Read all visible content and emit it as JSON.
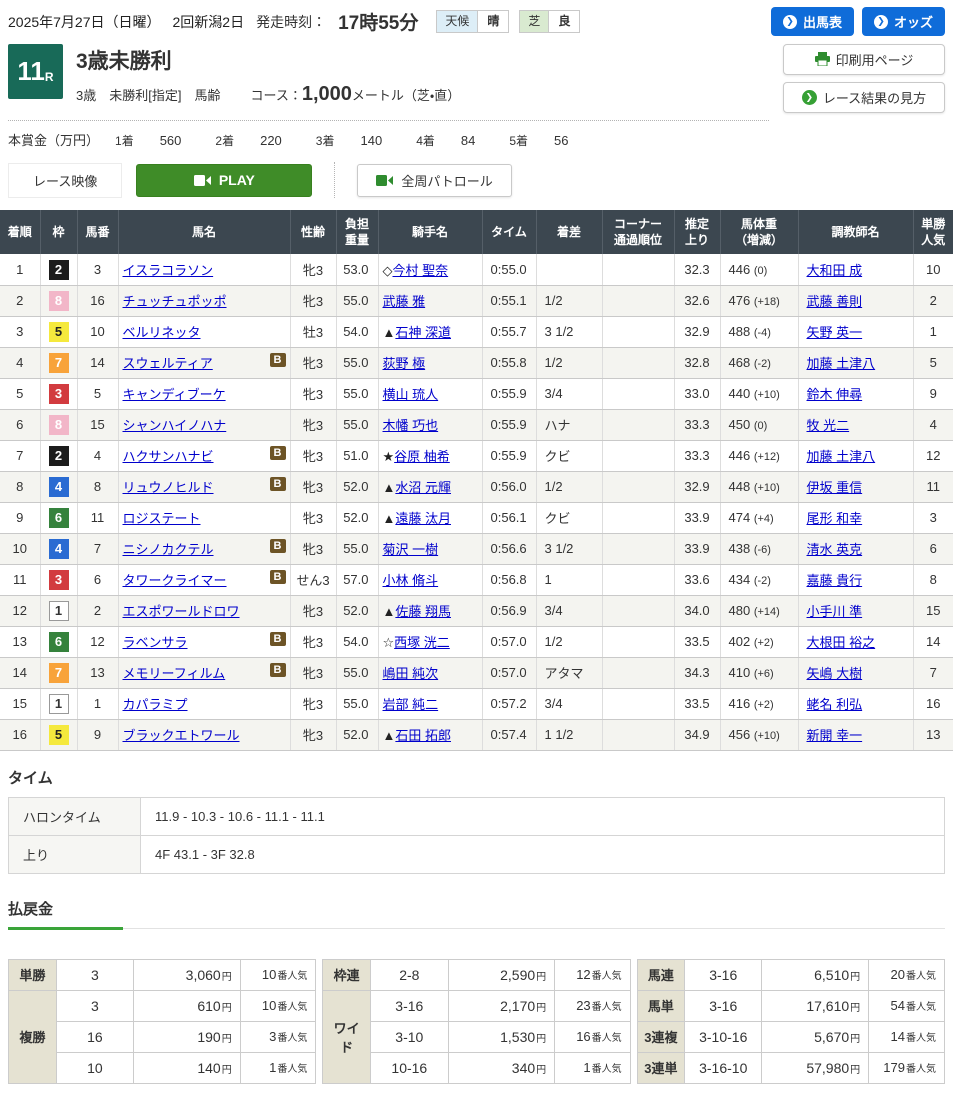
{
  "topbar": {
    "date": "2025年7月27日（日曜）",
    "meeting": "2回新潟2日",
    "start_label": "発走時刻：",
    "start_time": "17時55分",
    "weather_label": "天候",
    "weather_value": "晴",
    "turf_label": "芝",
    "turf_value": "良",
    "shutsuba_button": "出馬表",
    "odds_button": "オッズ"
  },
  "race": {
    "number": "11",
    "number_suffix": "R",
    "title": "3歳未勝利",
    "conditions": "3歳　未勝利[指定]　馬齢",
    "course_label": "コース：",
    "course_value": "1,000",
    "course_unit": "メートル（芝・直）",
    "print_button": "印刷用ページ",
    "guide_button": "レース結果の見方"
  },
  "prize": {
    "label": "本賞金（万円）",
    "items": [
      {
        "rank": "1着",
        "amount": "560"
      },
      {
        "rank": "2着",
        "amount": "220"
      },
      {
        "rank": "3着",
        "amount": "140"
      },
      {
        "rank": "4着",
        "amount": "84"
      },
      {
        "rank": "5着",
        "amount": "56"
      }
    ]
  },
  "video": {
    "label": "レース映像",
    "play_button": "PLAY",
    "patrol_button": "全周パトロール"
  },
  "colors": {
    "accent_blue": "#0f6cd9",
    "play_green": "#3f8c28",
    "icon_green": "#36a035",
    "race_number_teal": "#186a58",
    "table_header": "#3c4750",
    "link_blue": "#0000cc",
    "blinkers_brown": "#6d5426",
    "payout_label_bg": "#e5e2d2",
    "payout_underline_green": "#3aa439",
    "frames": {
      "white": {
        "bg": "#ffffff",
        "fg": "#333333",
        "border": "#999999"
      },
      "black": {
        "bg": "#1c1c1c",
        "fg": "#ffffff"
      },
      "red": {
        "bg": "#d23b3f",
        "fg": "#ffffff"
      },
      "blue": {
        "bg": "#2a6bd2",
        "fg": "#ffffff"
      },
      "yellow": {
        "bg": "#f5e93d",
        "fg": "#222222"
      },
      "green": {
        "bg": "#35823c",
        "fg": "#ffffff"
      },
      "orange": {
        "bg": "#f8a33a",
        "fg": "#ffffff"
      },
      "pink": {
        "bg": "#f2b6c8",
        "fg": "#ffffff"
      }
    }
  },
  "results": {
    "columns": [
      "着順",
      "枠",
      "馬番",
      "馬名",
      "性齢",
      "負担\n重量",
      "騎手名",
      "タイム",
      "着差",
      "コーナー\n通過順位",
      "推定\n上り",
      "馬体重\n（増減）",
      "調教師名",
      "単勝\n人気"
    ],
    "rows": [
      {
        "pos": "1",
        "frame": "2",
        "frame_color": "black",
        "num": "3",
        "horse": "イスラコラソン",
        "blinkers": false,
        "sex_age": "牝3",
        "weight": "53.0",
        "jockey_prefix": "◇",
        "jockey": "今村 聖奈",
        "time": "0:55.0",
        "margin": "",
        "corner": "",
        "last3f": "32.3",
        "body": "446",
        "body_diff": "(0)",
        "trainer": "大和田 成",
        "pop": "10"
      },
      {
        "pos": "2",
        "frame": "8",
        "frame_color": "pink",
        "num": "16",
        "horse": "チュッチュポッポ",
        "blinkers": false,
        "sex_age": "牝3",
        "weight": "55.0",
        "jockey_prefix": "",
        "jockey": "武藤 雅",
        "time": "0:55.1",
        "margin": "1/2",
        "corner": "",
        "last3f": "32.6",
        "body": "476",
        "body_diff": "(+18)",
        "trainer": "武藤 善則",
        "pop": "2"
      },
      {
        "pos": "3",
        "frame": "5",
        "frame_color": "yellow",
        "num": "10",
        "horse": "ベルリネッタ",
        "blinkers": false,
        "sex_age": "牡3",
        "weight": "54.0",
        "jockey_prefix": "▲",
        "jockey": "石神 深道",
        "time": "0:55.7",
        "margin": "3 1/2",
        "corner": "",
        "last3f": "32.9",
        "body": "488",
        "body_diff": "(-4)",
        "trainer": "矢野 英一",
        "pop": "1"
      },
      {
        "pos": "4",
        "frame": "7",
        "frame_color": "orange",
        "num": "14",
        "horse": "スウェルティア",
        "blinkers": true,
        "sex_age": "牝3",
        "weight": "55.0",
        "jockey_prefix": "",
        "jockey": "荻野 極",
        "time": "0:55.8",
        "margin": "1/2",
        "corner": "",
        "last3f": "32.8",
        "body": "468",
        "body_diff": "(-2)",
        "trainer": "加藤 土津八",
        "pop": "5"
      },
      {
        "pos": "5",
        "frame": "3",
        "frame_color": "red",
        "num": "5",
        "horse": "キャンディブーケ",
        "blinkers": false,
        "sex_age": "牝3",
        "weight": "55.0",
        "jockey_prefix": "",
        "jockey": "横山 琉人",
        "time": "0:55.9",
        "margin": "3/4",
        "corner": "",
        "last3f": "33.0",
        "body": "440",
        "body_diff": "(+10)",
        "trainer": "鈴木 伸尋",
        "pop": "9"
      },
      {
        "pos": "6",
        "frame": "8",
        "frame_color": "pink",
        "num": "15",
        "horse": "シャンハイノハナ",
        "blinkers": false,
        "sex_age": "牝3",
        "weight": "55.0",
        "jockey_prefix": "",
        "jockey": "木幡 巧也",
        "time": "0:55.9",
        "margin": "ハナ",
        "corner": "",
        "last3f": "33.3",
        "body": "450",
        "body_diff": "(0)",
        "trainer": "牧 光二",
        "pop": "4"
      },
      {
        "pos": "7",
        "frame": "2",
        "frame_color": "black",
        "num": "4",
        "horse": "ハクサンハナビ",
        "blinkers": true,
        "sex_age": "牝3",
        "weight": "51.0",
        "jockey_prefix": "★",
        "jockey": "谷原 柚希",
        "time": "0:55.9",
        "margin": "クビ",
        "corner": "",
        "last3f": "33.3",
        "body": "446",
        "body_diff": "(+12)",
        "trainer": "加藤 土津八",
        "pop": "12"
      },
      {
        "pos": "8",
        "frame": "4",
        "frame_color": "blue",
        "num": "8",
        "horse": "リュウノヒルド",
        "blinkers": true,
        "sex_age": "牝3",
        "weight": "52.0",
        "jockey_prefix": "▲",
        "jockey": "水沼 元輝",
        "time": "0:56.0",
        "margin": "1/2",
        "corner": "",
        "last3f": "32.9",
        "body": "448",
        "body_diff": "(+10)",
        "trainer": "伊坂 重信",
        "pop": "11"
      },
      {
        "pos": "9",
        "frame": "6",
        "frame_color": "green",
        "num": "11",
        "horse": "ロジステート",
        "blinkers": false,
        "sex_age": "牝3",
        "weight": "52.0",
        "jockey_prefix": "▲",
        "jockey": "遠藤 汰月",
        "time": "0:56.1",
        "margin": "クビ",
        "corner": "",
        "last3f": "33.9",
        "body": "474",
        "body_diff": "(+4)",
        "trainer": "尾形 和幸",
        "pop": "3"
      },
      {
        "pos": "10",
        "frame": "4",
        "frame_color": "blue",
        "num": "7",
        "horse": "ニシノカクテル",
        "blinkers": true,
        "sex_age": "牝3",
        "weight": "55.0",
        "jockey_prefix": "",
        "jockey": "菊沢 一樹",
        "time": "0:56.6",
        "margin": "3 1/2",
        "corner": "",
        "last3f": "33.9",
        "body": "438",
        "body_diff": "(-6)",
        "trainer": "清水 英克",
        "pop": "6"
      },
      {
        "pos": "11",
        "frame": "3",
        "frame_color": "red",
        "num": "6",
        "horse": "タワークライマー",
        "blinkers": true,
        "sex_age": "せん3",
        "weight": "57.0",
        "jockey_prefix": "",
        "jockey": "小林 脩斗",
        "time": "0:56.8",
        "margin": "1",
        "corner": "",
        "last3f": "33.6",
        "body": "434",
        "body_diff": "(-2)",
        "trainer": "嘉藤 貴行",
        "pop": "8"
      },
      {
        "pos": "12",
        "frame": "1",
        "frame_color": "white",
        "num": "2",
        "horse": "エスポワールドロワ",
        "blinkers": false,
        "sex_age": "牝3",
        "weight": "52.0",
        "jockey_prefix": "▲",
        "jockey": "佐藤 翔馬",
        "time": "0:56.9",
        "margin": "3/4",
        "corner": "",
        "last3f": "34.0",
        "body": "480",
        "body_diff": "(+14)",
        "trainer": "小手川 準",
        "pop": "15"
      },
      {
        "pos": "13",
        "frame": "6",
        "frame_color": "green",
        "num": "12",
        "horse": "ラベンサラ",
        "blinkers": true,
        "sex_age": "牝3",
        "weight": "54.0",
        "jockey_prefix": "☆",
        "jockey": "西塚 洸二",
        "time": "0:57.0",
        "margin": "1/2",
        "corner": "",
        "last3f": "33.5",
        "body": "402",
        "body_diff": "(+2)",
        "trainer": "大根田 裕之",
        "pop": "14"
      },
      {
        "pos": "14",
        "frame": "7",
        "frame_color": "orange",
        "num": "13",
        "horse": "メモリーフィルム",
        "blinkers": true,
        "sex_age": "牝3",
        "weight": "55.0",
        "jockey_prefix": "",
        "jockey": "嶋田 純次",
        "time": "0:57.0",
        "margin": "アタマ",
        "corner": "",
        "last3f": "34.3",
        "body": "410",
        "body_diff": "(+6)",
        "trainer": "矢嶋 大樹",
        "pop": "7"
      },
      {
        "pos": "15",
        "frame": "1",
        "frame_color": "white",
        "num": "1",
        "horse": "カパラミプ",
        "blinkers": false,
        "sex_age": "牝3",
        "weight": "55.0",
        "jockey_prefix": "",
        "jockey": "岩部 純二",
        "time": "0:57.2",
        "margin": "3/4",
        "corner": "",
        "last3f": "33.5",
        "body": "416",
        "body_diff": "(+2)",
        "trainer": "蛯名 利弘",
        "pop": "16"
      },
      {
        "pos": "16",
        "frame": "5",
        "frame_color": "yellow",
        "num": "9",
        "horse": "ブラックエトワール",
        "blinkers": false,
        "sex_age": "牝3",
        "weight": "52.0",
        "jockey_prefix": "▲",
        "jockey": "石田 拓郎",
        "time": "0:57.4",
        "margin": "1 1/2",
        "corner": "",
        "last3f": "34.9",
        "body": "456",
        "body_diff": "(+10)",
        "trainer": "新開 幸一",
        "pop": "13"
      }
    ]
  },
  "time_section": {
    "heading": "タイム",
    "rows": [
      {
        "label": "ハロンタイム",
        "value": "11.9 - 10.3 - 10.6 - 11.1 - 11.1"
      },
      {
        "label": "上り",
        "value": "4F 43.1 - 3F 32.8"
      }
    ]
  },
  "payout": {
    "heading": "払戻金",
    "yen_suffix": "円",
    "ninki_suffix": "番人気",
    "groups": [
      [
        {
          "label": "単勝",
          "rows": [
            {
              "combo": "3",
              "amount": "3,060",
              "pop": "10"
            }
          ]
        },
        {
          "label": "複勝",
          "rows": [
            {
              "combo": "3",
              "amount": "610",
              "pop": "10"
            },
            {
              "combo": "16",
              "amount": "190",
              "pop": "3"
            },
            {
              "combo": "10",
              "amount": "140",
              "pop": "1"
            }
          ]
        }
      ],
      [
        {
          "label": "枠連",
          "rows": [
            {
              "combo": "2-8",
              "amount": "2,590",
              "pop": "12"
            }
          ]
        },
        {
          "label": "ワイド",
          "rows": [
            {
              "combo": "3-16",
              "amount": "2,170",
              "pop": "23"
            },
            {
              "combo": "3-10",
              "amount": "1,530",
              "pop": "16"
            },
            {
              "combo": "10-16",
              "amount": "340",
              "pop": "1"
            }
          ]
        }
      ],
      [
        {
          "label": "馬連",
          "rows": [
            {
              "combo": "3-16",
              "amount": "6,510",
              "pop": "20"
            }
          ]
        },
        {
          "label": "馬単",
          "rows": [
            {
              "combo": "3-16",
              "amount": "17,610",
              "pop": "54"
            }
          ]
        },
        {
          "label": "3連複",
          "rows": [
            {
              "combo": "3-10-16",
              "amount": "5,670",
              "pop": "14"
            }
          ]
        },
        {
          "label": "3連単",
          "rows": [
            {
              "combo": "3-16-10",
              "amount": "57,980",
              "pop": "179"
            }
          ]
        }
      ]
    ]
  }
}
